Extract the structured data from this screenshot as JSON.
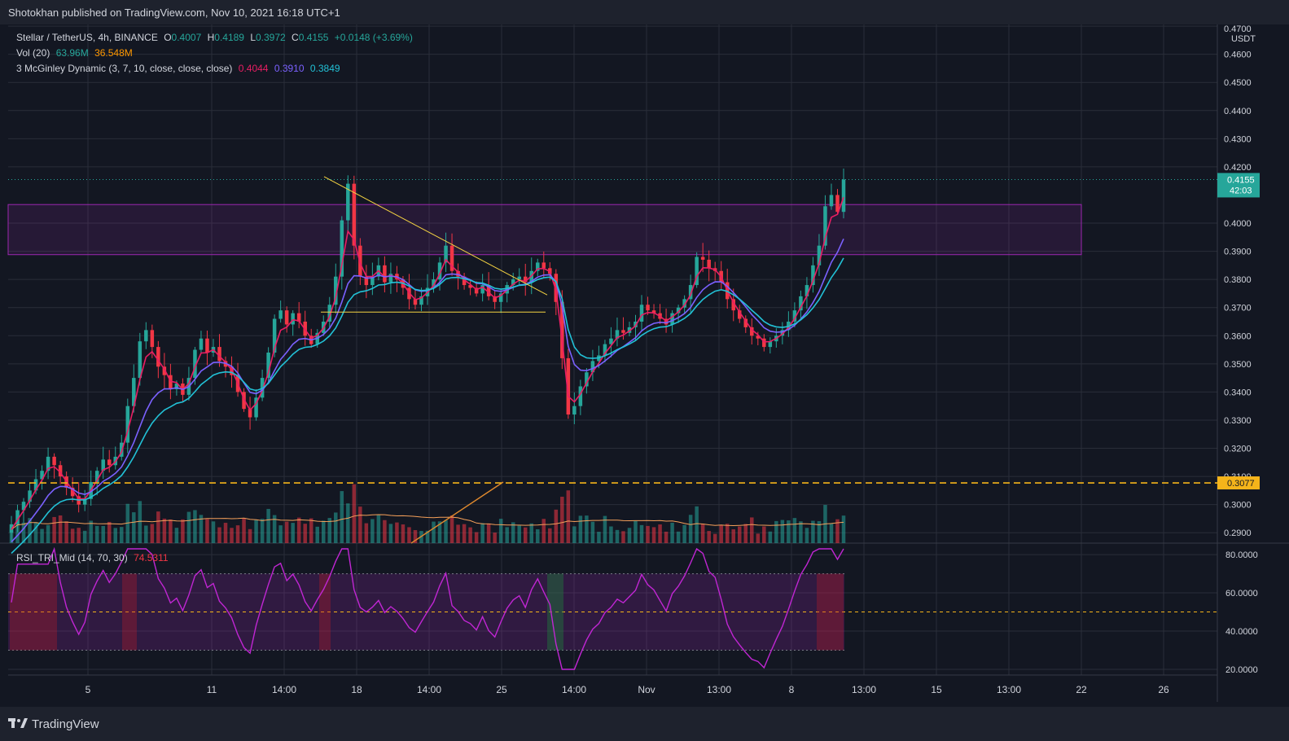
{
  "header": {
    "published": "Shotokhan published on TradingView.com, Nov 10, 2021 16:18 UTC+1"
  },
  "footer": {
    "brand": "TradingView"
  },
  "legend": {
    "symbol": "Stellar / TetherUS, 4h, BINANCE",
    "o_label": "O",
    "o_value": "0.4007",
    "h_label": "H",
    "h_value": "0.4189",
    "l_label": "L",
    "l_value": "0.3972",
    "c_label": "C",
    "c_value": "0.4155",
    "change": "+0.0148 (+3.69%)",
    "vol_label": "Vol (20)",
    "vol_value1": "63.96M",
    "vol_value2": "36.548M",
    "mcg_label": "3 McGinley Dynamic (3, 7, 10, close, close, close)",
    "mcg_v1": "0.4044",
    "mcg_v2": "0.3910",
    "mcg_v3": "0.3849",
    "rsi_label": "RSI_TRI_Mid (14, 70, 30)",
    "rsi_value": "74.5311"
  },
  "colors": {
    "background": "#131722",
    "grid": "#2a2e39",
    "up": "#26a69a",
    "down": "#f23645",
    "mcg1": "#e91e63",
    "mcg2": "#7b61ff",
    "mcg3": "#22c1d6",
    "rsi": "#c026d3",
    "support": "#f5b41a",
    "zone": "#9c27b0",
    "trend": "#f5d442",
    "last_price": "#26a69a"
  },
  "chart_data": {
    "type": "candlestick",
    "symbol": "Stellar / TetherUS",
    "interval": "4h",
    "exchange": "BINANCE",
    "currency": "USDT",
    "y_ticks": [
      "0.4700",
      "0.4600",
      "0.4500",
      "0.4400",
      "0.4300",
      "0.4200",
      "0.4000",
      "0.3900",
      "0.3800",
      "0.3700",
      "0.3600",
      "0.3500",
      "0.3400",
      "0.3300",
      "0.3200",
      "0.3100",
      "0.3000",
      "0.2900"
    ],
    "ylim": [
      0.2863,
      0.4706
    ],
    "x_ticks": [
      "5",
      "11",
      "14:00",
      "18",
      "14:00",
      "25",
      "14:00",
      "Nov",
      "13:00",
      "8",
      "13:00",
      "15",
      "13:00",
      "22",
      "26"
    ],
    "last_price": "0.4155",
    "countdown": "42:03",
    "support_level": "0.3077",
    "resistance_zone": [
      0.3888,
      0.4066
    ],
    "closes": [
      0.293,
      0.298,
      0.301,
      0.305,
      0.309,
      0.312,
      0.317,
      0.314,
      0.31,
      0.306,
      0.303,
      0.3,
      0.302,
      0.308,
      0.312,
      0.316,
      0.314,
      0.317,
      0.322,
      0.335,
      0.345,
      0.358,
      0.362,
      0.356,
      0.349,
      0.346,
      0.341,
      0.343,
      0.339,
      0.345,
      0.355,
      0.359,
      0.354,
      0.356,
      0.351,
      0.349,
      0.346,
      0.34,
      0.334,
      0.331,
      0.338,
      0.345,
      0.354,
      0.366,
      0.369,
      0.364,
      0.368,
      0.365,
      0.36,
      0.357,
      0.361,
      0.365,
      0.371,
      0.381,
      0.401,
      0.414,
      0.392,
      0.381,
      0.378,
      0.381,
      0.385,
      0.379,
      0.382,
      0.38,
      0.377,
      0.373,
      0.371,
      0.374,
      0.377,
      0.38,
      0.386,
      0.392,
      0.383,
      0.381,
      0.378,
      0.377,
      0.375,
      0.378,
      0.374,
      0.372,
      0.375,
      0.378,
      0.38,
      0.381,
      0.379,
      0.383,
      0.386,
      0.384,
      0.382,
      0.372,
      0.352,
      0.332,
      0.335,
      0.342,
      0.347,
      0.351,
      0.353,
      0.357,
      0.359,
      0.362,
      0.361,
      0.363,
      0.365,
      0.371,
      0.369,
      0.368,
      0.366,
      0.364,
      0.368,
      0.37,
      0.373,
      0.378,
      0.388,
      0.387,
      0.384,
      0.383,
      0.379,
      0.373,
      0.369,
      0.366,
      0.363,
      0.36,
      0.359,
      0.356,
      0.358,
      0.36,
      0.362,
      0.365,
      0.369,
      0.374,
      0.378,
      0.385,
      0.392,
      0.406,
      0.41,
      0.404,
      0.4155
    ],
    "mcginley": [
      {
        "period": 3,
        "last": "0.4044"
      },
      {
        "period": 7,
        "last": "0.3910"
      },
      {
        "period": 10,
        "last": "0.3849"
      }
    ],
    "volume": {
      "ma_period": 20,
      "last": "63.96M",
      "ma_last": "36.548M"
    },
    "rsi": {
      "period": 14,
      "upper": 70,
      "lower": 30,
      "last": "74.5311",
      "y_ticks": [
        "80.0000",
        "60.0000",
        "40.0000",
        "20.0000"
      ],
      "ylim": [
        17,
        86
      ]
    }
  }
}
